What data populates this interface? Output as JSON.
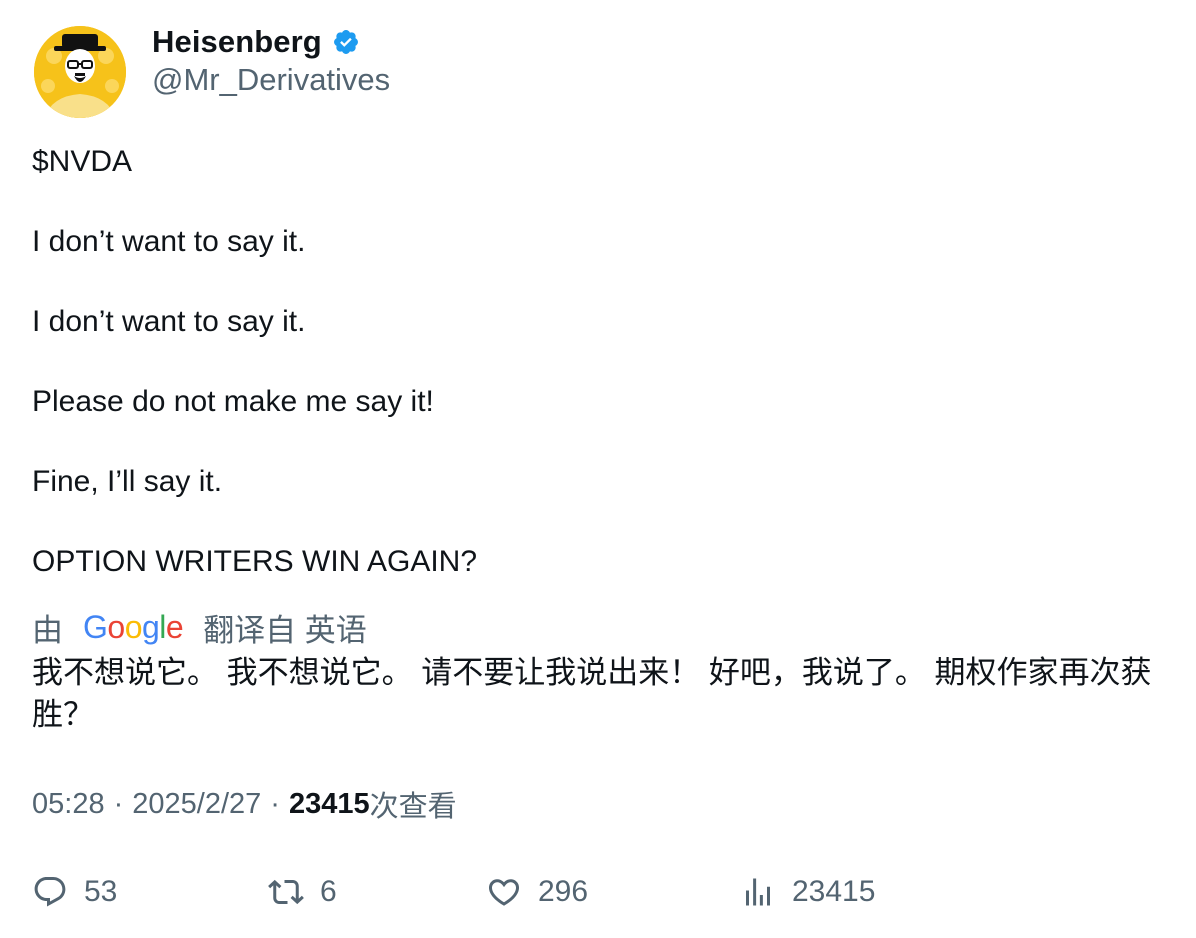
{
  "author": {
    "display_name": "Heisenberg",
    "handle": "@Mr_Derivatives",
    "verified": true,
    "avatar_icon": "heisenberg-avatar"
  },
  "tweet": {
    "lines": [
      "$NVDA",
      "I don’t want to say it.",
      "I don’t want to say it.",
      "Please do not make me say it!",
      "Fine, I’ll say it.",
      "OPTION WRITERS WIN AGAIN?"
    ]
  },
  "translation": {
    "prefix": "由",
    "provider": "Google",
    "suffix": "翻译自 英语",
    "text": "我不想说它。 我不想说它。 请不要让我说出来！ 好吧，我说了。 期权作家再次获胜？"
  },
  "meta": {
    "time": "05:28",
    "date": "2025/2/27",
    "views_count": "23415",
    "views_label": "次查看"
  },
  "actions": {
    "replies": "53",
    "retweets": "6",
    "likes": "296",
    "views": "23415"
  },
  "colors": {
    "text_primary": "#0f1419",
    "text_secondary": "#536471",
    "verified_blue": "#1d9bf0",
    "avatar_bg": "#f6c21a"
  }
}
